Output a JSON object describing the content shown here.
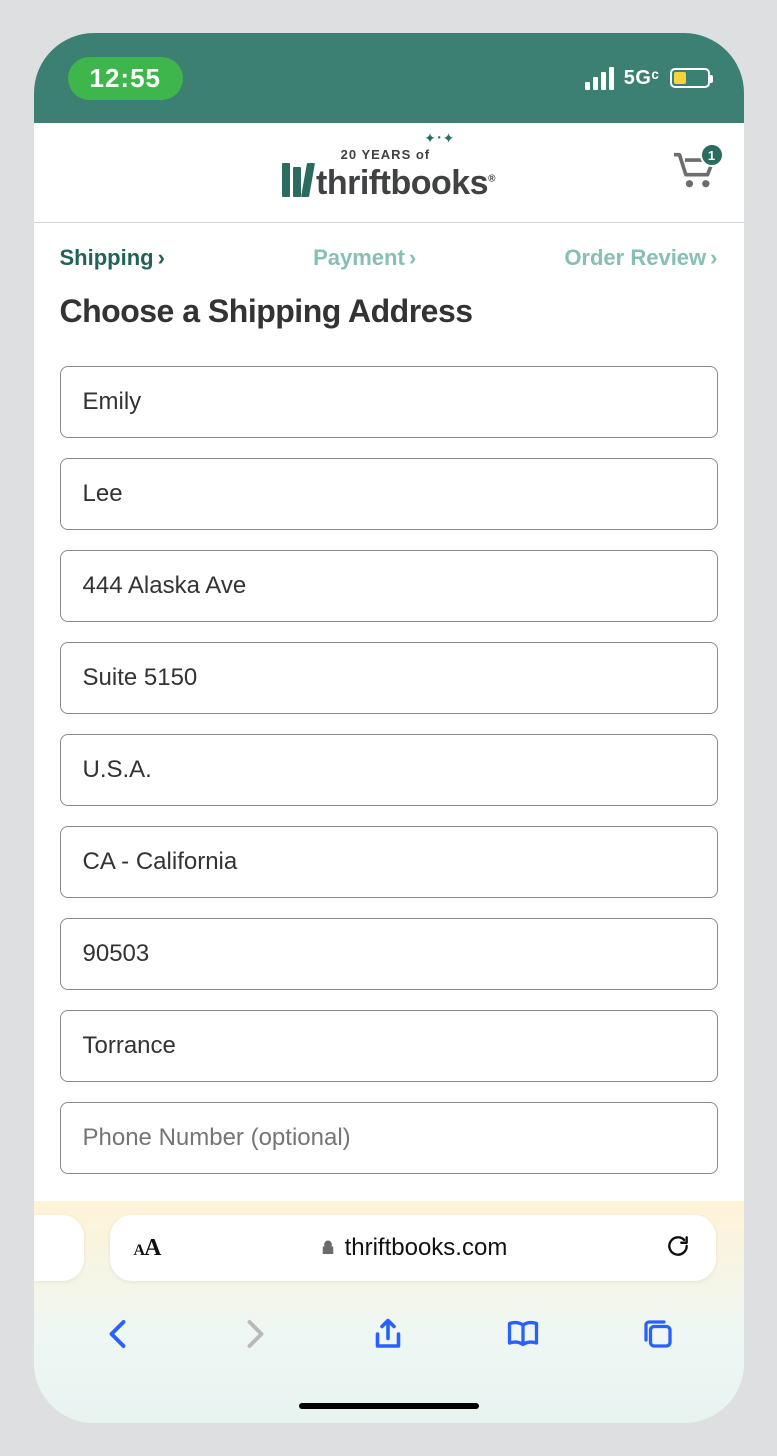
{
  "status": {
    "time": "12:55",
    "network": "5Gᶜ"
  },
  "header": {
    "logo_tag": "20 YEARS of",
    "logo_text_a": "thrift",
    "logo_text_b": "books",
    "cart_count": "1"
  },
  "breadcrumbs": {
    "step1": "Shipping",
    "step2": "Payment",
    "step3": "Order Review"
  },
  "page": {
    "title": "Choose a Shipping Address"
  },
  "form": {
    "first_name": "Emily",
    "last_name": "Lee",
    "address1": "444 Alaska Ave",
    "address2": "Suite 5150",
    "country": "U.S.A.",
    "state": "CA - California",
    "zip": "90503",
    "city": "Torrance",
    "phone_placeholder": "Phone Number (optional)"
  },
  "browser": {
    "text_size_label_small": "A",
    "text_size_label_large": "A",
    "host": "thriftbooks.com"
  }
}
